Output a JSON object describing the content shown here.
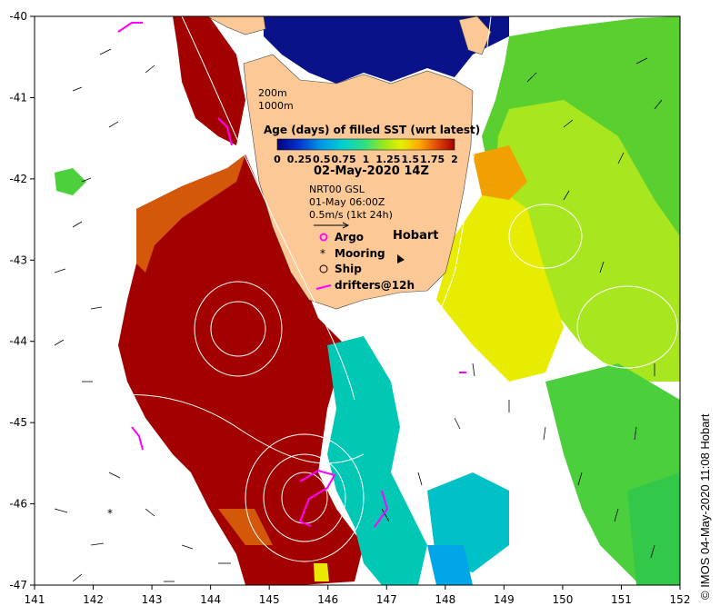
{
  "map": {
    "x_ticks": [
      "141",
      "142",
      "143",
      "144",
      "145",
      "146",
      "147",
      "148",
      "149",
      "150",
      "151",
      "152"
    ],
    "y_ticks": [
      "-40",
      "-41",
      "-42",
      "-43",
      "-44",
      "-45",
      "-46",
      "-47"
    ],
    "lon_range": [
      141,
      152
    ],
    "lat_range": [
      -47,
      -40
    ]
  },
  "legend": {
    "depth_200": "200m",
    "depth_1000": "1000m",
    "colorbar_title": "Age (days) of filled SST (wrt latest)",
    "colorbar_labels": [
      "0",
      "0.25",
      "0.5",
      "0.75",
      "1",
      "1.25",
      "1.5",
      "1.75",
      "2"
    ],
    "colorbar_colors": [
      "#00007f",
      "#0033cc",
      "#0099e6",
      "#00d0d0",
      "#33e07a",
      "#9be61e",
      "#e6ee00",
      "#ffaa00",
      "#e04a0a",
      "#a30000"
    ],
    "date": "02-May-2020 14Z",
    "current_source": "NRT00 GSL",
    "current_time": "01-May 06:00Z",
    "vector_scale": "0.5m/s (1kt 24h)",
    "argo_label": "Argo",
    "mooring_label": "Mooring",
    "ship_label": "Ship",
    "drifters_label": "drifters@12h"
  },
  "places": {
    "hobart": "Hobart"
  },
  "credit": "© IMOS 04-May-2020 11:08 Hobart",
  "colors": {
    "land": "#fbc896",
    "argo": "#ff00ff",
    "drifter": "#ff00ff",
    "contour": "#ffffff"
  }
}
